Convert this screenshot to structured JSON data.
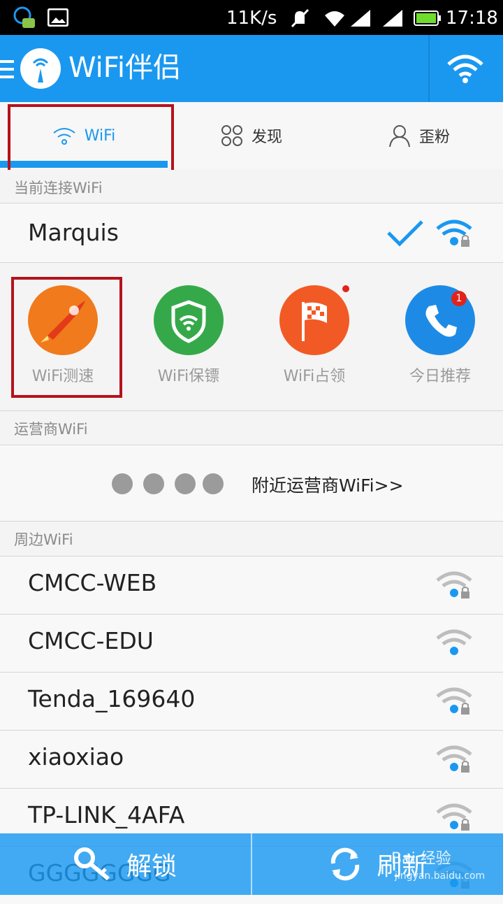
{
  "status_bar": {
    "speed": "11K/s",
    "time": "17:18"
  },
  "app_bar": {
    "title": "WiFi伴侣"
  },
  "tabs": [
    {
      "label": "WiFi",
      "active": true
    },
    {
      "label": "发现",
      "active": false
    },
    {
      "label": "歪粉",
      "active": false
    }
  ],
  "current": {
    "header": "当前连接WiFi",
    "ssid": "Marquis"
  },
  "tools": [
    {
      "label": "WiFi测速",
      "icon": "rocket-icon",
      "color": "#f07a1c"
    },
    {
      "label": "WiFi保镖",
      "icon": "shield-wifi-icon",
      "color": "#35a94a"
    },
    {
      "label": "WiFi占领",
      "icon": "checkered-flag-icon",
      "color": "#f25a25"
    },
    {
      "label": "今日推荐",
      "icon": "phone-icon",
      "color": "#1d8be6",
      "badge": "1"
    }
  ],
  "carrier": {
    "header": "运营商WiFi",
    "link": "附近运营商WiFi>>"
  },
  "nearby": {
    "header": "周边WiFi",
    "networks": [
      {
        "ssid": "CMCC-WEB",
        "locked": true
      },
      {
        "ssid": "CMCC-EDU",
        "locked": false
      },
      {
        "ssid": "Tenda_169640",
        "locked": true
      },
      {
        "ssid": "xiaoxiao",
        "locked": true
      },
      {
        "ssid": "TP-LINK_4AFA",
        "locked": true
      },
      {
        "ssid": "GGGGGGGG",
        "locked": true
      }
    ]
  },
  "bottom_bar": {
    "unlock": "解锁",
    "refresh": "刷新"
  },
  "watermark": {
    "text": "Bai 经验",
    "url": "jingyan.baidu.com"
  }
}
